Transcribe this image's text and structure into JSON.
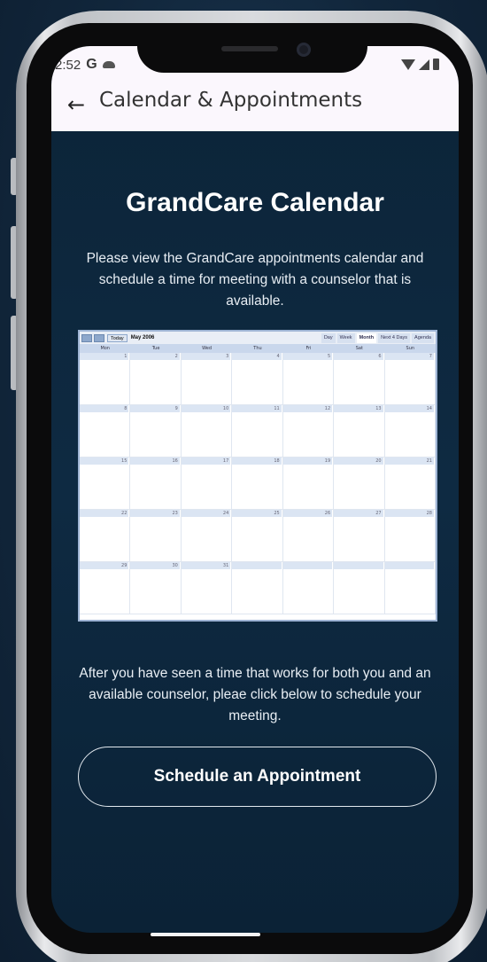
{
  "status_bar": {
    "time": "2:52",
    "google_letter": "G",
    "icons": [
      "cloud-icon",
      "wifi-icon",
      "signal-icon",
      "battery-icon"
    ]
  },
  "app_bar": {
    "back_icon": "←",
    "title": "Calendar & Appointments"
  },
  "main": {
    "heading": "GrandCare Calendar",
    "intro": "Please view the GrandCare appointments calendar and schedule a time for meeting with a counselor that is available.",
    "after_text": "After you have seen a time that works for both you and an available counselor, pleae click below to schedule your meeting.",
    "schedule_button": "Schedule an Appointment"
  },
  "calendar_image": {
    "today_label": "Today",
    "month_label": "May 2006",
    "views": [
      "Day",
      "Week",
      "Month",
      "Next 4 Days",
      "Agenda"
    ],
    "active_view": "Month",
    "weekdays": [
      "Mon",
      "Tue",
      "Wed",
      "Thu",
      "Fri",
      "Sat",
      "Sun"
    ],
    "days": [
      "1",
      "2",
      "3",
      "4",
      "5",
      "6",
      "7",
      "8",
      "9",
      "10",
      "11",
      "12",
      "13",
      "14",
      "15",
      "16",
      "17",
      "18",
      "19",
      "20",
      "21",
      "22",
      "23",
      "24",
      "25",
      "26",
      "27",
      "28",
      "29",
      "30",
      "31",
      "",
      "",
      "",
      ""
    ]
  },
  "colors": {
    "screen_bg": "#0e2a42",
    "appbar_bg": "#fbf7fd",
    "button_border": "#e2e8ee"
  }
}
